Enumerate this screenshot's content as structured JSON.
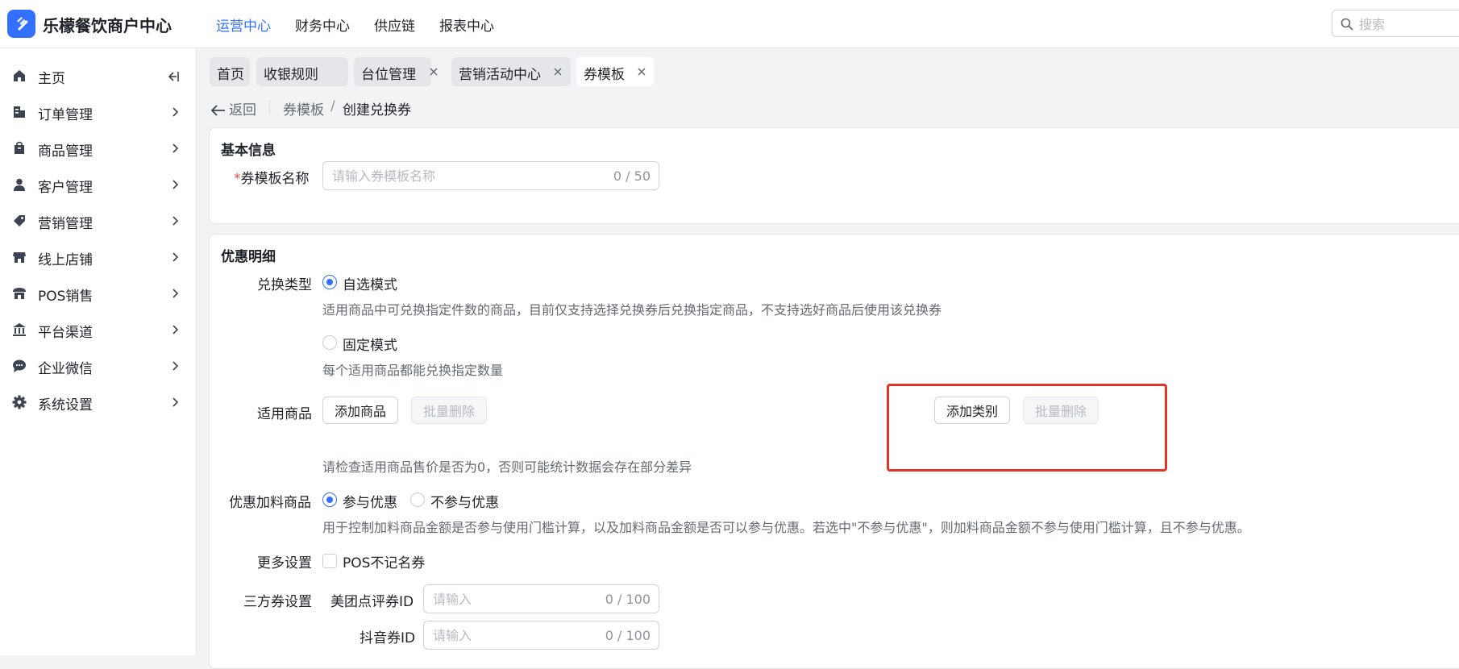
{
  "app": {
    "brand": "乐檬餐饮商户中心",
    "top_nav": [
      {
        "label": "运营中心",
        "active": true
      },
      {
        "label": "财务中心",
        "active": false
      },
      {
        "label": "供应链",
        "active": false
      },
      {
        "label": "报表中心",
        "active": false
      }
    ],
    "search_placeholder": "搜索",
    "accent_color": "#3370ff"
  },
  "sidebar": {
    "items": [
      {
        "label": "主页",
        "icon": "home-icon"
      },
      {
        "label": "订单管理",
        "icon": "order-icon"
      },
      {
        "label": "商品管理",
        "icon": "bag-icon"
      },
      {
        "label": "客户管理",
        "icon": "user-icon"
      },
      {
        "label": "营销管理",
        "icon": "tag-icon"
      },
      {
        "label": "线上店铺",
        "icon": "shop-icon"
      },
      {
        "label": "POS销售",
        "icon": "store-icon"
      },
      {
        "label": "平台渠道",
        "icon": "bank-icon"
      },
      {
        "label": "企业微信",
        "icon": "chat-icon"
      },
      {
        "label": "系统设置",
        "icon": "gear-icon"
      }
    ]
  },
  "tabs": [
    {
      "label": "首页",
      "closable": false,
      "active": false
    },
    {
      "label": "收银规则",
      "closable": true,
      "active": false
    },
    {
      "label": "台位管理",
      "closable": true,
      "active": false
    },
    {
      "label": "营销活动中心",
      "closable": true,
      "active": false
    },
    {
      "label": "券模板",
      "closable": true,
      "active": true
    }
  ],
  "breadcrumb": {
    "back": "返回",
    "parent": "券模板",
    "separator": "/",
    "current": "创建兑换券"
  },
  "basic_info": {
    "title": "基本信息",
    "required_mark": "*",
    "name_label": "券模板名称",
    "name_placeholder": "请输入券模板名称",
    "name_value": "",
    "name_count": "0 / 50"
  },
  "discount": {
    "title": "优惠明细",
    "exchange_type_label": "兑换类型",
    "mode_custom": "自选模式",
    "mode_custom_desc": "适用商品中可兑换指定件数的商品，目前仅支持选择兑换券后兑换指定商品，不支持选好商品后使用该兑换券",
    "mode_fixed": "固定模式",
    "mode_fixed_desc": "每个适用商品都能兑换指定数量",
    "selected_mode": "自选模式",
    "applicable_label": "适用商品",
    "add_product": "添加商品",
    "batch_delete": "批量删除",
    "add_category": "添加类别",
    "batch_delete_category": "批量删除",
    "price_hint": "请检查适用商品售价是否为0，否则可能统计数据会存在部分差异",
    "addon_label": "优惠加料商品",
    "addon_yes": "参与优惠",
    "addon_no": "不参与优惠",
    "addon_selected": "参与优惠",
    "addon_desc": "用于控制加料商品金额是否参与使用门槛计算，以及加料商品金额是否可以参与优惠。若选中\"不参与优惠\"，则加料商品金额不参与使用门槛计算，且不参与优惠。",
    "more_label": "更多设置",
    "pos_anon": "POS不记名券",
    "pos_anon_checked": false,
    "third_party_label": "三方券设置",
    "meituan_label": "美团点评券ID",
    "meituan_placeholder": "请输入",
    "meituan_count": "0 / 100",
    "douyin_label": "抖音券ID",
    "douyin_placeholder": "请输入",
    "douyin_count": "0 / 100"
  },
  "highlight_color": "#e03424"
}
